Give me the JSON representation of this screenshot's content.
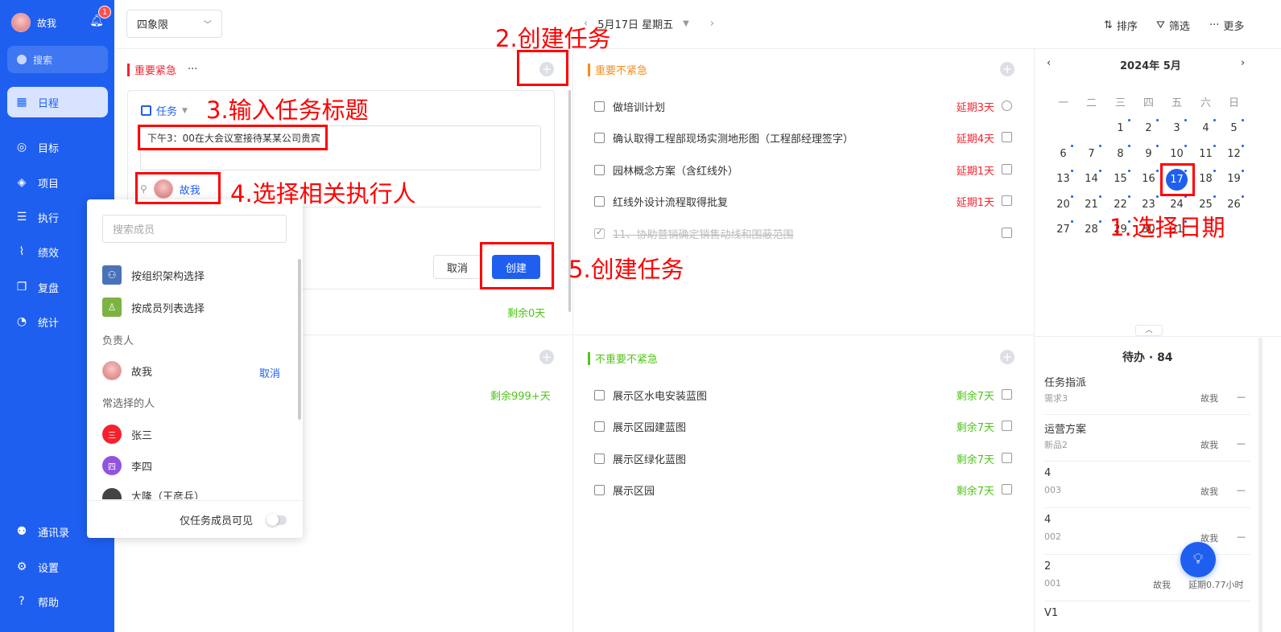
{
  "sidebar": {
    "user_name": "故我",
    "notif_count": "1",
    "search_placeholder": "搜索",
    "items": [
      {
        "label": "日程",
        "icon": "calendar-icon",
        "active": true
      },
      {
        "label": "目标",
        "icon": "target-icon"
      },
      {
        "label": "项目",
        "icon": "cube-icon"
      },
      {
        "label": "执行",
        "icon": "checklist-icon"
      },
      {
        "label": "绩效",
        "icon": "chart-icon"
      },
      {
        "label": "复盘",
        "icon": "review-icon"
      },
      {
        "label": "统计",
        "icon": "pie-icon"
      }
    ],
    "bottom": [
      {
        "label": "通讯录",
        "icon": "contacts-icon"
      },
      {
        "label": "设置",
        "icon": "gear-icon"
      },
      {
        "label": "帮助",
        "icon": "help-icon"
      }
    ]
  },
  "header": {
    "view_select": "四象限",
    "date_label": "5月17日 星期五",
    "sort_label": "排序",
    "filter_label": "筛选",
    "more_label": "更多"
  },
  "q1": {
    "title": "重要紧急",
    "more": "···",
    "color": "#f5222d",
    "new_task": {
      "type_label": "任务",
      "title_value": "下午3：00在大会议室接待某某公司贵宾",
      "assignee": "故我",
      "cancel_label": "取消",
      "create_label": "创建"
    },
    "remaining": "剩余0天"
  },
  "q2": {
    "title": "重要不紧急",
    "color": "#fa8c16",
    "tasks": [
      {
        "text": "做培训计划",
        "status": "延期3天",
        "done": false
      },
      {
        "text": "确认取得工程部现场实测地形图（工程部经理签字）",
        "status": "延期4天",
        "done": false
      },
      {
        "text": "园林概念方案（含红线外）",
        "status": "延期1天",
        "done": false
      },
      {
        "text": "红线外设计流程取得批复",
        "status": "延期1天",
        "done": false
      },
      {
        "text": "11、协助营销确定销售动线和围蔽范围",
        "status": "",
        "done": true
      }
    ]
  },
  "q3": {
    "remaining": "剩余999+天"
  },
  "q4": {
    "title": "不重要不紧急",
    "color": "#52c41a",
    "tasks": [
      {
        "text": "展示区水电安装蓝图",
        "status": "剩余7天"
      },
      {
        "text": "展示区园建蓝图",
        "status": "剩余7天"
      },
      {
        "text": "展示区绿化蓝图",
        "status": "剩余7天"
      },
      {
        "text": "展示区园",
        "status": "剩余7天"
      }
    ]
  },
  "member_popup": {
    "search_placeholder": "搜索成员",
    "by_org": "按组织架构选择",
    "by_list": "按成员列表选择",
    "owner_heading": "负责人",
    "owner_name": "故我",
    "owner_cancel": "取消",
    "frequent_heading": "常选择的人",
    "frequent": [
      {
        "name": "张三",
        "badge": "三",
        "color": "#f5222d"
      },
      {
        "name": "李四",
        "badge": "四",
        "color": "#9254de"
      },
      {
        "name": "大隆（王彦兵）",
        "badge": "",
        "color": "#444444"
      }
    ],
    "visibility_label": "仅任务成员可见"
  },
  "calendar": {
    "title": "2024年 5月",
    "weekdays": [
      "一",
      "二",
      "三",
      "四",
      "五",
      "六",
      "日"
    ],
    "days": [
      [
        "",
        "",
        "1",
        "2",
        "3",
        "4",
        "5"
      ],
      [
        "6",
        "7",
        "8",
        "9",
        "10",
        "11",
        "12"
      ],
      [
        "13",
        "14",
        "15",
        "16",
        "17",
        "18",
        "19"
      ],
      [
        "20",
        "21",
        "22",
        "23",
        "24",
        "25",
        "26"
      ],
      [
        "27",
        "28",
        "29",
        "30",
        "31",
        "",
        ""
      ]
    ],
    "selected": "17"
  },
  "todo": {
    "heading": "待办 · 84",
    "items": [
      {
        "title": "任务指派",
        "sub": "需求3",
        "owner": "故我",
        "status": "—"
      },
      {
        "title": "运营方案",
        "sub": "新品2",
        "owner": "故我",
        "status": "—"
      },
      {
        "title": "4",
        "sub": "003",
        "owner": "故我",
        "status": "—"
      },
      {
        "title": "4",
        "sub": "002",
        "owner": "故我",
        "status": "—"
      },
      {
        "title": "2",
        "sub": "001",
        "owner": "故我",
        "status": "延期0.77小时"
      },
      {
        "title": "V1",
        "sub": "",
        "owner": "",
        "status": ""
      }
    ]
  },
  "annotations": {
    "a1": "1.选择日期",
    "a2": "2.创建任务",
    "a3": "3.输入任务标题",
    "a4": "4.选择相关执行人",
    "a5": "5.创建任务"
  }
}
